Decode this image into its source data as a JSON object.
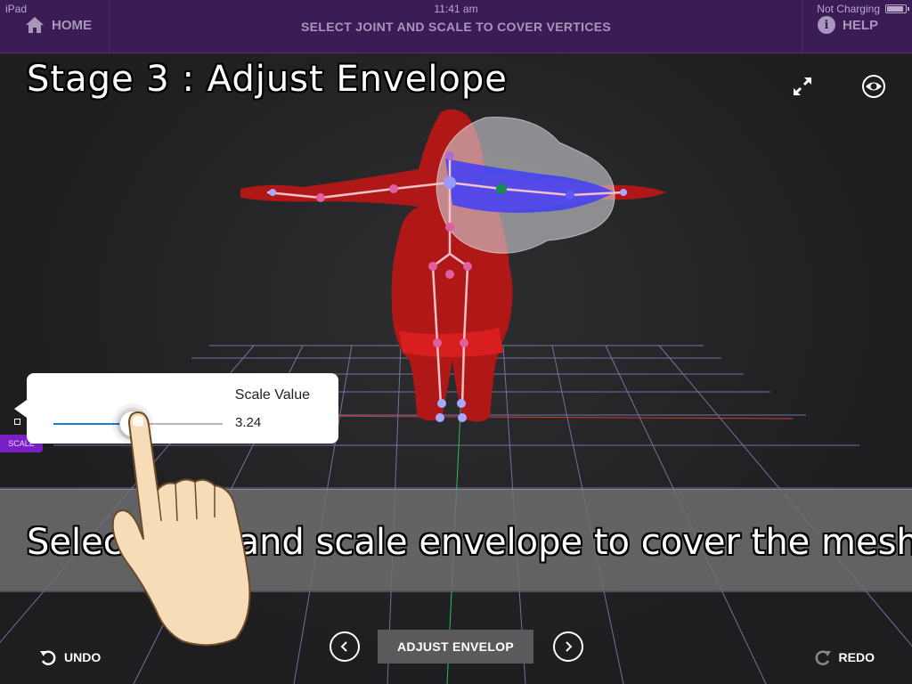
{
  "status_bar": {
    "carrier": "iPad",
    "time": "11:41 am",
    "battery_status": "Not Charging",
    "battery_level": 0.9
  },
  "header": {
    "home_label": "HOME",
    "title": "SELECT JOINT AND SCALE TO COVER VERTICES",
    "help_label": "HELP",
    "help_icon_glyph": "i"
  },
  "viewport": {
    "stage_title": "Stage 3 : Adjust Envelope",
    "caption": "Select joint and scale envelope to cover the mesh",
    "fullscreen_icon": "expand-arrows-icon",
    "visibility_icon": "eye-icon"
  },
  "scale_popover": {
    "label": "Scale Value",
    "value": "3.24",
    "slider_level": 0.47
  },
  "side_tab": {
    "label": "SCALE"
  },
  "bottom_bar": {
    "undo_label": "UNDO",
    "redo_label": "REDO",
    "mode_label": "ADJUST ENVELOP",
    "prev_icon": "chevron-left-icon",
    "next_icon": "chevron-right-icon"
  },
  "colors": {
    "header_bg": "#3b1c55",
    "header_text": "#a996bb",
    "accent_purple": "#7a1fc6",
    "mesh_red": "#b01818",
    "envelope_blue": "#3a3aff",
    "slider_blue": "#1a7fd8",
    "grid_line": "#8c8cc8"
  }
}
